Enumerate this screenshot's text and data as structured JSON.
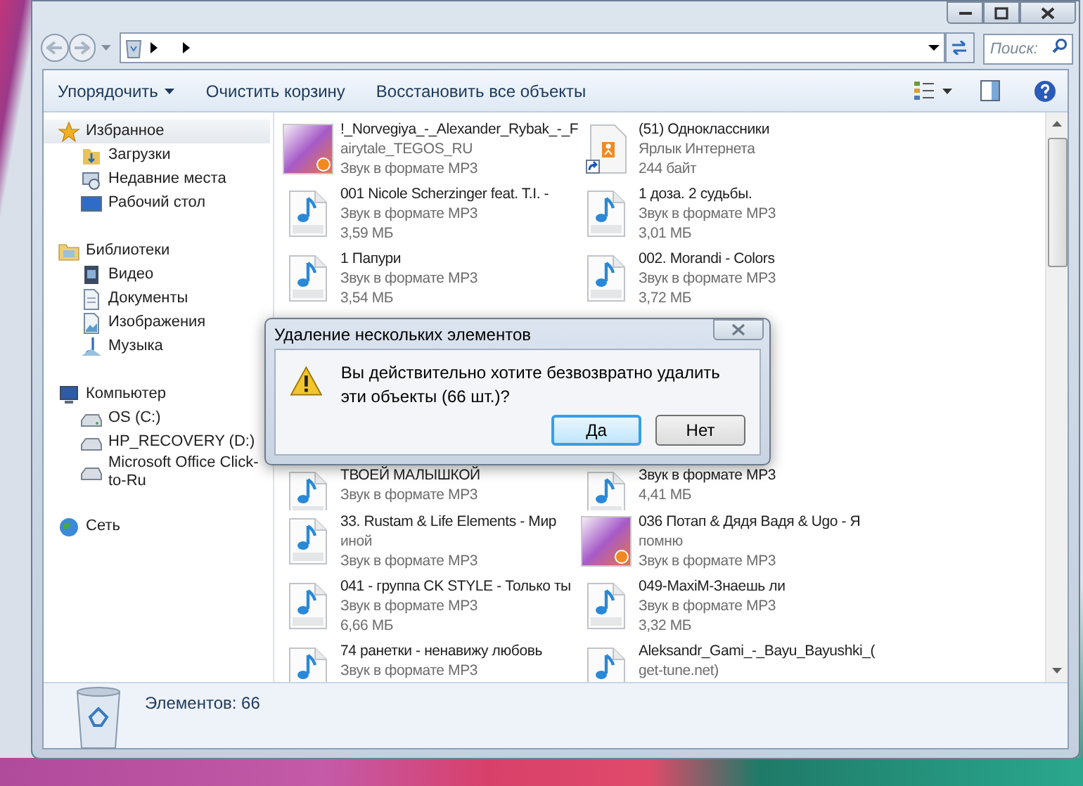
{
  "address": {
    "search_placeholder": "Поиск:"
  },
  "toolbar": {
    "buttons": [
      {
        "label": "Упорядочить",
        "dropdown": true
      },
      {
        "label": "Очистить корзину",
        "dropdown": false
      },
      {
        "label": "Восстановить все объекты",
        "dropdown": false
      }
    ]
  },
  "sidebar": {
    "groups": [
      {
        "label": "Избранное",
        "selected": true,
        "children": [
          {
            "label": "Загрузки",
            "selected": false
          },
          {
            "label": "Недавние места",
            "selected": false
          },
          {
            "label": "Рабочий стол",
            "selected": false
          }
        ]
      },
      {
        "label": "Библиотеки",
        "selected": false,
        "children": [
          {
            "label": "Видео",
            "selected": false
          },
          {
            "label": "Документы",
            "selected": false
          },
          {
            "label": "Изображения",
            "selected": false
          },
          {
            "label": "Музыка",
            "selected": false
          }
        ]
      },
      {
        "label": "Компьютер",
        "selected": false,
        "children": [
          {
            "label": "OS (C:)",
            "selected": false
          },
          {
            "label": "HP_RECOVERY (D:)",
            "selected": false
          },
          {
            "label": "Microsoft Office Click-to-Ru",
            "selected": false
          }
        ]
      },
      {
        "label": "Сеть",
        "selected": false
      }
    ]
  },
  "files_top": [
    {
      "kind": "album",
      "lines": [
        "!_Norvegiya_-_Alexander_Rybak_-_F",
        "airytale_TEGOS_RU",
        "Звук в формате MP3"
      ]
    },
    {
      "kind": "shortcut",
      "lines": [
        "(51) Одноклассники",
        "Ярлык Интернета",
        "244 байт"
      ]
    },
    {
      "kind": "mp3",
      "lines": [
        "001 Nicole Scherzinger feat. T.I. -",
        "Звук в формате MP3",
        "3,59 МБ"
      ]
    },
    {
      "kind": "mp3",
      "lines": [
        "1 доза. 2 судьбы.",
        "Звук в формате MP3",
        "3,01 МБ"
      ]
    },
    {
      "kind": "mp3",
      "lines": [
        "1 Папури",
        "Звук в формате MP3",
        "3,54 МБ"
      ]
    },
    {
      "kind": "mp3",
      "lines": [
        "002. Morandi - Colors",
        "Звук в формате MP3",
        "3,72 МБ"
      ]
    }
  ],
  "files_bottom": [
    {
      "kind": "mp3",
      "lines": [
        "ТВОЕЙ МАЛЫШКОЙ",
        "Звук в формате MP3"
      ]
    },
    {
      "kind": "mp3",
      "lines": [
        "Звук в формате MP3",
        "4,41 МБ"
      ]
    },
    {
      "kind": "mp3",
      "lines": [
        "33. Rustam & Life Elements - Мир",
        "иной",
        "Звук в формате MP3"
      ]
    },
    {
      "kind": "album",
      "lines": [
        "036 Потап & Дядя Вадя & Ugo - Я",
        "помню",
        "Звук в формате MP3"
      ]
    },
    {
      "kind": "mp3",
      "lines": [
        "041 - группа CK STYLE - Только ты",
        "Звук в формате MP3",
        "6,66 МБ"
      ]
    },
    {
      "kind": "mp3",
      "lines": [
        "049-MaxiM-Знаешь ли",
        "Звук в формате MP3",
        "3,32 МБ"
      ]
    },
    {
      "kind": "mp3",
      "lines": [
        "74 ранетки - ненавижу любовь",
        "Звук в формате MP3"
      ]
    },
    {
      "kind": "mp3",
      "lines": [
        "Aleksandr_Gami_-_Bayu_Bayushki_(",
        "get-tune.net)"
      ]
    }
  ],
  "status_bar": {
    "text": "Элементов: 66"
  },
  "dialog": {
    "title": "Удаление нескольких элементов",
    "message": "Вы действительно хотите безвозвратно удалить эти объекты (66 шт.)?",
    "buttons": [
      {
        "label": "Да",
        "selected": true
      },
      {
        "label": "Нет",
        "selected": false
      }
    ]
  }
}
